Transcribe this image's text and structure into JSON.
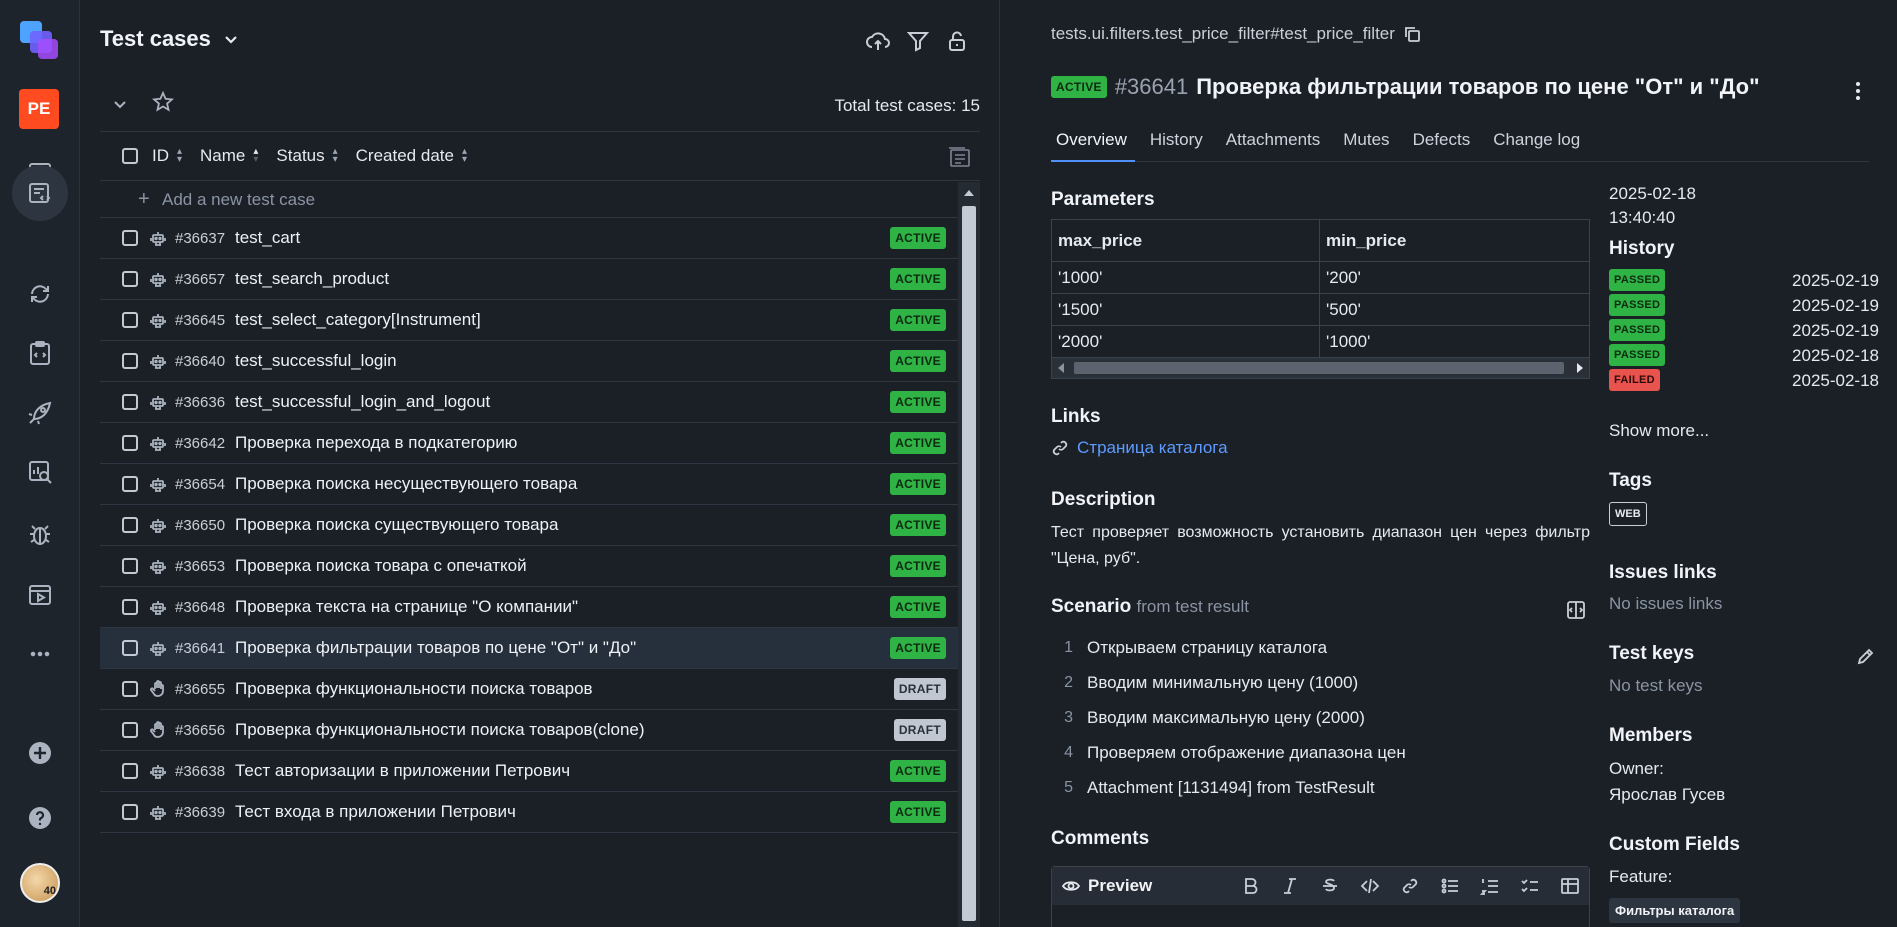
{
  "rail": {
    "badge": "PE",
    "avatar_text": "40"
  },
  "list": {
    "title": "Test cases",
    "total": "Total test cases: 15",
    "columns": [
      "ID",
      "Name",
      "Status",
      "Created date"
    ],
    "add_case": "Add a new test case",
    "rows": [
      {
        "id": "#36637",
        "name": "test_cart",
        "status": "ACTIVE",
        "icon": "robot-icon"
      },
      {
        "id": "#36657",
        "name": "test_search_product",
        "status": "ACTIVE",
        "icon": "robot-icon"
      },
      {
        "id": "#36645",
        "name": "test_select_category[Instrument]",
        "status": "ACTIVE",
        "icon": "robot-icon"
      },
      {
        "id": "#36640",
        "name": "test_successful_login",
        "status": "ACTIVE",
        "icon": "robot-icon"
      },
      {
        "id": "#36636",
        "name": "test_successful_login_and_logout",
        "status": "ACTIVE",
        "icon": "robot-icon"
      },
      {
        "id": "#36642",
        "name": "Проверка перехода в подкатегорию",
        "status": "ACTIVE",
        "icon": "robot-icon"
      },
      {
        "id": "#36654",
        "name": "Проверка поиска несуществующего товара",
        "status": "ACTIVE",
        "icon": "robot-icon"
      },
      {
        "id": "#36650",
        "name": "Проверка поиска существующего товара",
        "status": "ACTIVE",
        "icon": "robot-icon"
      },
      {
        "id": "#36653",
        "name": "Проверка поиска товара с опечаткой",
        "status": "ACTIVE",
        "icon": "robot-icon"
      },
      {
        "id": "#36648",
        "name": "Проверка текста на странице \"О компании\"",
        "status": "ACTIVE",
        "icon": "robot-icon"
      },
      {
        "id": "#36641",
        "name": "Проверка фильтрации товаров по цене \"От\" и \"До\"",
        "status": "ACTIVE",
        "icon": "robot-icon",
        "selected": true
      },
      {
        "id": "#36655",
        "name": "Проверка функциональности поиска товаров",
        "status": "DRAFT",
        "icon": "hand-icon"
      },
      {
        "id": "#36656",
        "name": "Проверка функциональности поиска товаров(clone)",
        "status": "DRAFT",
        "icon": "hand-icon"
      },
      {
        "id": "#36638",
        "name": "Тест авторизации в приложении Петрович",
        "status": "ACTIVE",
        "icon": "robot-icon"
      },
      {
        "id": "#36639",
        "name": "Тест входа в приложении Петрович",
        "status": "ACTIVE",
        "icon": "robot-icon"
      }
    ]
  },
  "detail": {
    "full_name": "tests.ui.filters.test_price_filter#test_price_filter",
    "status": "ACTIVE",
    "id": "#36641",
    "title": "Проверка фильтрации товаров по цене \"От\" и \"До\"",
    "tabs": [
      "Overview",
      "History",
      "Attachments",
      "Mutes",
      "Defects",
      "Change log"
    ],
    "parameters_heading": "Parameters",
    "parameters": {
      "headers": [
        "max_price",
        "min_price"
      ],
      "rows": [
        [
          "'1000'",
          "'200'"
        ],
        [
          "'1500'",
          "'500'"
        ],
        [
          "'2000'",
          "'1000'"
        ]
      ]
    },
    "links_heading": "Links",
    "link_text": "Страница каталога",
    "description_heading": "Description",
    "description": "Тест проверяет возможность установить диапазон цен через фильтр \"Цена, руб\".",
    "scenario_heading": "Scenario",
    "scenario_source": "from test result",
    "steps": [
      "Открываем страницу каталога",
      "Вводим минимальную цену (1000)",
      "Вводим максимальную цену (2000)",
      "Проверяем отображение диапазона цен",
      "Attachment [1131494] from TestResult"
    ],
    "comments_heading": "Comments",
    "preview_label": "Preview"
  },
  "side": {
    "created_date": "2025-02-18",
    "created_time": "13:40:40",
    "history_heading": "History",
    "history": [
      {
        "status": "PASSED",
        "date": "2025-02-19"
      },
      {
        "status": "PASSED",
        "date": "2025-02-19"
      },
      {
        "status": "PASSED",
        "date": "2025-02-19"
      },
      {
        "status": "PASSED",
        "date": "2025-02-18"
      },
      {
        "status": "FAILED",
        "date": "2025-02-18"
      }
    ],
    "show_more": "Show more...",
    "tags_heading": "Tags",
    "tag": "WEB",
    "issues_heading": "Issues links",
    "issues_empty": "No issues links",
    "keys_heading": "Test keys",
    "keys_empty": "No test keys",
    "members_heading": "Members",
    "owner_label": "Owner:",
    "owner": "Ярослав Гусев",
    "custom_heading": "Custom Fields",
    "feature_label": "Feature:",
    "feature_value": "Фильтры каталога"
  },
  "colors": {
    "accent": "#4f8ff7",
    "active": "#2fb344",
    "failed": "#e9534e",
    "brand": "#ff4b1f"
  }
}
